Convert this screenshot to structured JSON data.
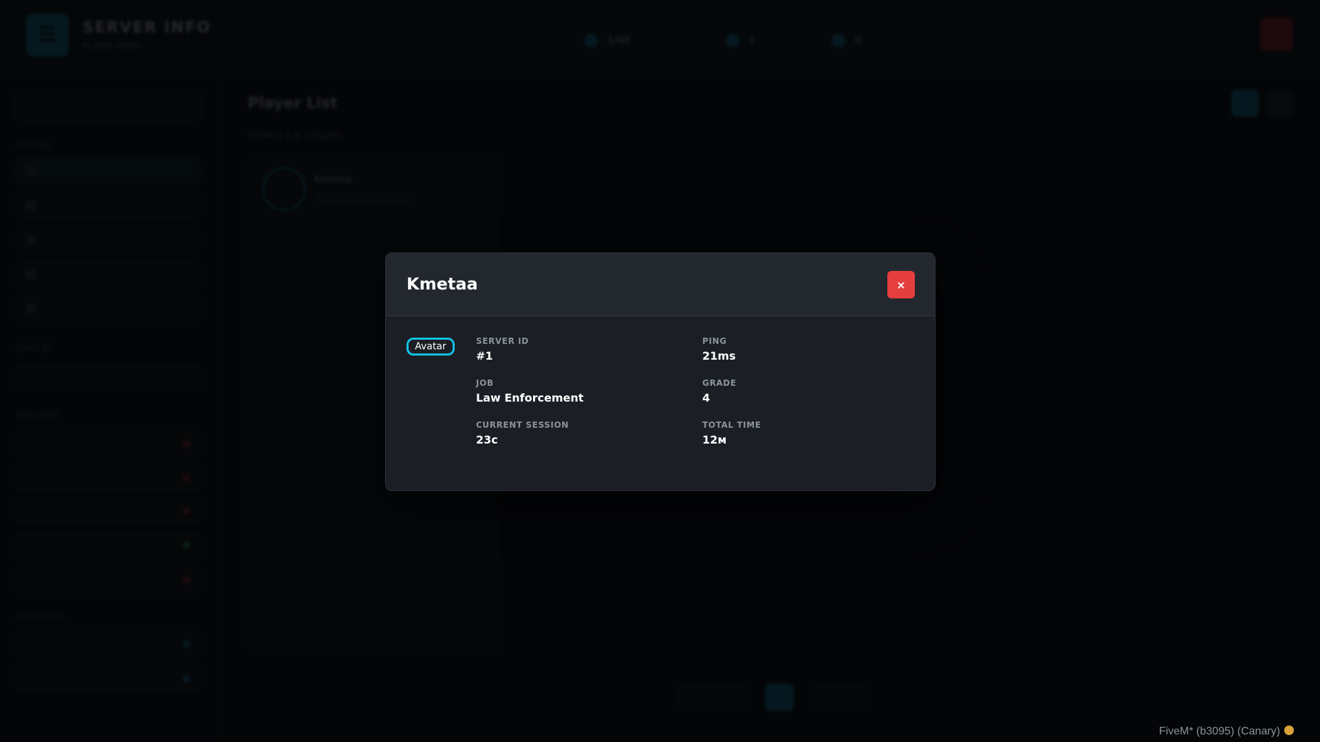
{
  "background": {
    "brand": {
      "title": "SERVER INFO",
      "subtitle": "PLAYER MENU"
    },
    "stats": [
      "1/48",
      "1",
      "0"
    ],
    "main_title": "Player List",
    "main_subtitle": "Showing 1 of 1 players",
    "player_card": {
      "name": "Kmetaa"
    }
  },
  "modal": {
    "title": "Kmetaa",
    "close_label": "×",
    "avatar_alt": "Avatar",
    "fields": [
      {
        "label": "SERVER ID",
        "value": "#1"
      },
      {
        "label": "PING",
        "value": "21ms"
      },
      {
        "label": "JOB",
        "value": "Law Enforcement"
      },
      {
        "label": "GRADE",
        "value": "4"
      },
      {
        "label": "CURRENT SESSION",
        "value": "23с"
      },
      {
        "label": "TOTAL TIME",
        "value": "12м"
      }
    ]
  },
  "footer": {
    "text": "FiveM* (b3095) (Canary)"
  },
  "colors": {
    "accent": "#11c4e6",
    "danger": "#e53e3e",
    "modal_bg": "#1b1f25",
    "header_bg": "#23272e"
  }
}
